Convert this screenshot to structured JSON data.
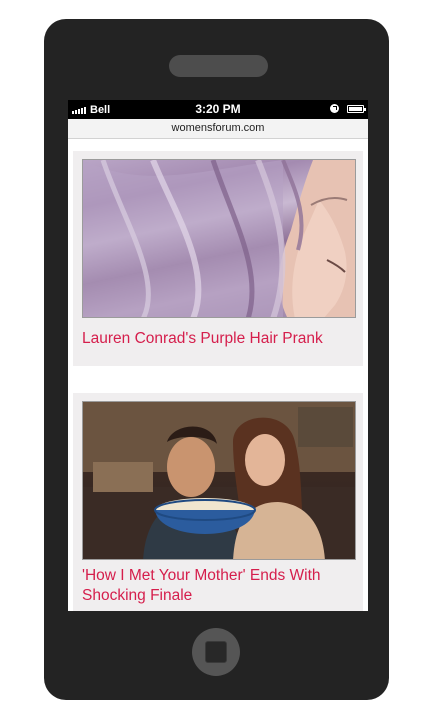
{
  "status_bar": {
    "carrier": "Bell",
    "time": "3:20 PM"
  },
  "browser": {
    "url": "womensforum.com"
  },
  "articles": [
    {
      "title": "Lauren Conrad's Purple Hair Prank",
      "image": "woman-purple-hair-photo"
    },
    {
      "title": "'How I Met Your Mother' Ends With Shocking Finale",
      "image": "couple-popcorn-photo"
    }
  ],
  "colors": {
    "headline": "#d51e4c",
    "phone_body": "#232323",
    "card_bg": "#f0eeef"
  }
}
